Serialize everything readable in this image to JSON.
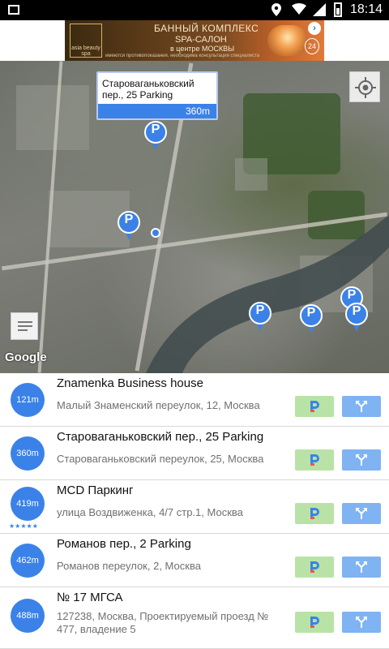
{
  "status": {
    "time": "18:14"
  },
  "ad": {
    "brand": "asia beauty spa",
    "line1": "БАННЫЙ КОМПЛЕКС",
    "line2": "SPA-САЛОН",
    "line3": "в центре МОСКВЫ",
    "line4": "имеются противопоказания. необходима консультация специалиста",
    "hours": "24"
  },
  "map": {
    "popup_title": "Староваганьковский пер., 25 Parking",
    "popup_distance": "360m",
    "pin_label": "P",
    "attribution": "Google"
  },
  "list": [
    {
      "distance": "121m",
      "title": "Znamenka Business house",
      "address": "Малый Знаменский переулок, 12, Москва",
      "rating": null
    },
    {
      "distance": "360m",
      "title": "Староваганьковский пер., 25 Parking",
      "address": "Староваганьковский переулок, 25, Москва",
      "rating": null
    },
    {
      "distance": "419m",
      "title": "MCD Паркинг",
      "address": "улица Воздвиженка, 4/7 стр.1, Москва",
      "rating": "★★★★★"
    },
    {
      "distance": "462m",
      "title": "Романов пер., 2 Parking",
      "address": "Романов переулок, 2, Москва",
      "rating": null
    },
    {
      "distance": "488m",
      "title": "№ 17 МГСА",
      "address": "127238, Москва, Проектируемый проезд № 477, владение 5",
      "rating": null
    }
  ],
  "colors": {
    "accent": "#3b82e8",
    "reserve_btn": "#b9e3a6",
    "route_btn": "#7fb3f2"
  }
}
